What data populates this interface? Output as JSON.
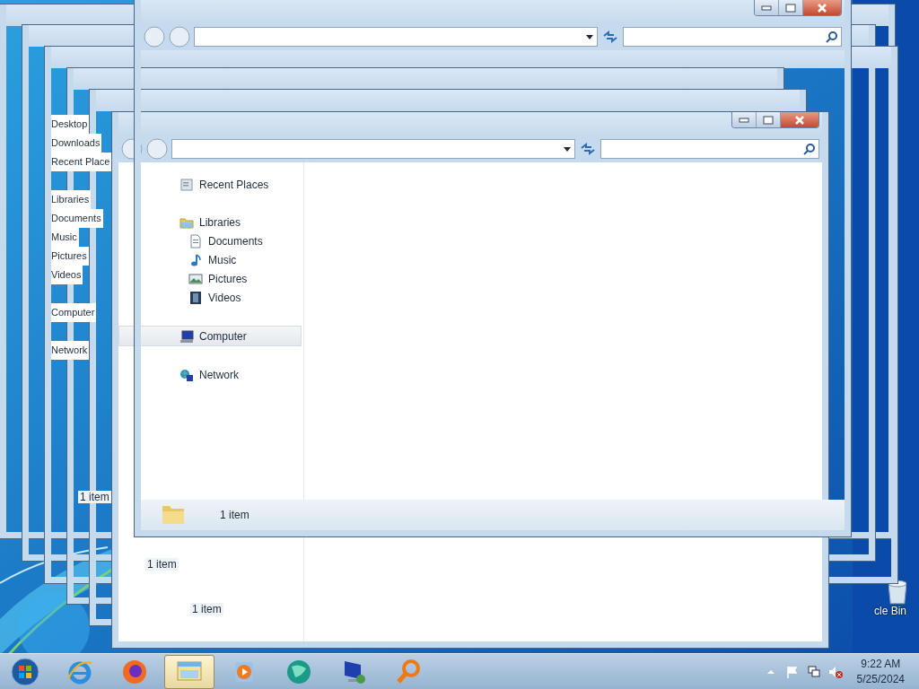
{
  "desktop": {
    "icons": [
      {
        "label": "cle Bin"
      }
    ]
  },
  "windows": [
    {
      "kind": "frame",
      "status": "1 item"
    },
    {
      "kind": "frame"
    },
    {
      "kind": "frame",
      "nav": [
        {
          "label": "Desktop",
          "kind": "leaf"
        },
        {
          "label": "Downloads",
          "kind": "leaf"
        },
        {
          "label": "Recent Place",
          "kind": "leaf"
        },
        {
          "label": "Libraries",
          "kind": "group"
        },
        {
          "label": "Documents",
          "kind": "leaf"
        },
        {
          "label": "Music",
          "kind": "leaf"
        },
        {
          "label": "Pictures",
          "kind": "leaf"
        },
        {
          "label": "Videos",
          "kind": "leaf"
        },
        {
          "label": "Computer",
          "kind": "group"
        },
        {
          "label": "Network",
          "kind": "group"
        }
      ],
      "status": "1 item"
    },
    {
      "kind": "frame"
    },
    {
      "kind": "frame",
      "status": "1 item"
    },
    {
      "kind": "explorer",
      "nav": [
        {
          "label": "Recent Places",
          "kind": "recent",
          "selected": false
        },
        {
          "label": "Libraries",
          "kind": "library",
          "selected": false,
          "children": [
            {
              "label": "Documents",
              "kind": "documents",
              "selected": false
            },
            {
              "label": "Music",
              "kind": "music",
              "selected": false
            },
            {
              "label": "Pictures",
              "kind": "pictures",
              "selected": false
            },
            {
              "label": "Videos",
              "kind": "videos",
              "selected": false
            }
          ]
        },
        {
          "label": "Computer",
          "kind": "computer",
          "selected": true
        },
        {
          "label": "Network",
          "kind": "network",
          "selected": false
        }
      ]
    },
    {
      "kind": "ghost",
      "status": "1 item"
    }
  ],
  "taskbar": {
    "apps": [
      {
        "kind": "start",
        "selected": false
      },
      {
        "kind": "ie",
        "selected": false
      },
      {
        "kind": "firefox",
        "selected": false
      },
      {
        "kind": "explorer",
        "selected": true
      },
      {
        "kind": "media",
        "selected": false
      },
      {
        "kind": "globe",
        "selected": false
      },
      {
        "kind": "remote",
        "selected": false
      },
      {
        "kind": "magnifier",
        "selected": false
      }
    ],
    "clock": {
      "time": "9:22 AM",
      "date": "5/25/2024"
    }
  }
}
